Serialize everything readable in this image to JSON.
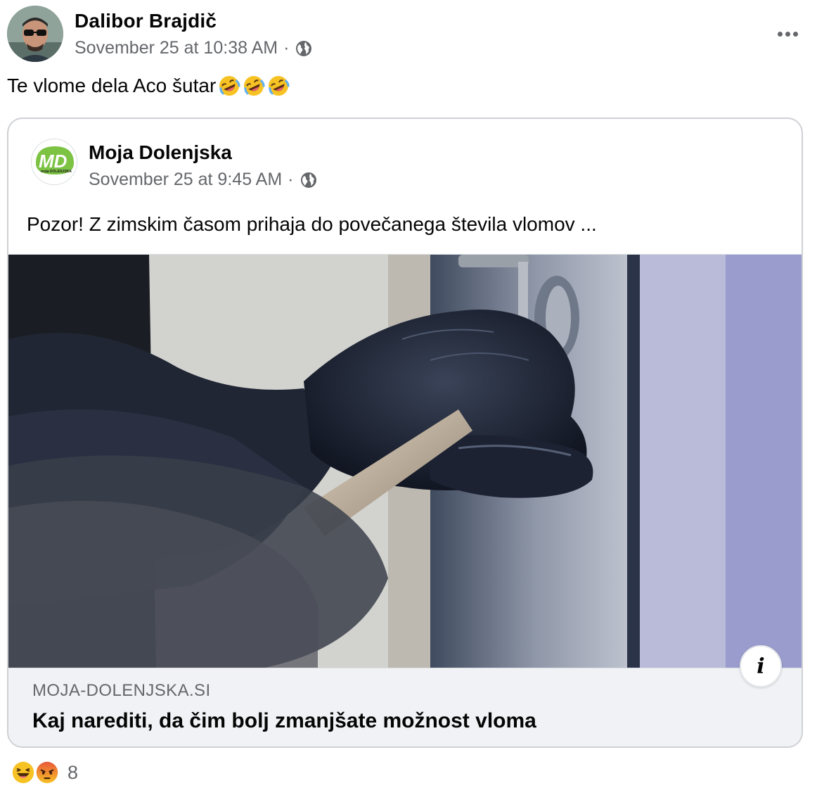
{
  "post": {
    "author": "Dalibor Brajdič",
    "timestamp": "Sovember 25 at 10:38 AM",
    "separator": "·",
    "privacy_icon": "globe-icon",
    "more_icon": "more-horizontal-icon",
    "text": "Te vlome dela Aco šutar",
    "emoji": [
      "rolling-on-floor-laughing-icon",
      "rolling-on-floor-laughing-icon",
      "rolling-on-floor-laughing-icon"
    ]
  },
  "shared": {
    "page_name": "Moja Dolenjska",
    "logo_text": "MD",
    "logo_subtext": "moja DOLENJSKA",
    "timestamp": "Sovember 25 at 9:45 AM",
    "separator": "·",
    "privacy_icon": "globe-icon",
    "text": "Pozor! Z zimskim časom prihaja do povečanega števila vlomov ...",
    "image_description_icon": "info-icon",
    "info_glyph": "i",
    "link_domain": "MOJA-DOLENJSKA.SI",
    "link_title": "Kaj narediti, da čim bolj zmanjšate možnost vloma"
  },
  "reactions": {
    "icons": [
      "haha-icon",
      "angry-icon"
    ],
    "count": "8"
  },
  "colors": {
    "text_primary": "#050505",
    "text_secondary": "#65676b",
    "card_border": "#ced0d4",
    "link_footer_bg": "#f0f2f5",
    "logo_green": "#7cc243"
  }
}
